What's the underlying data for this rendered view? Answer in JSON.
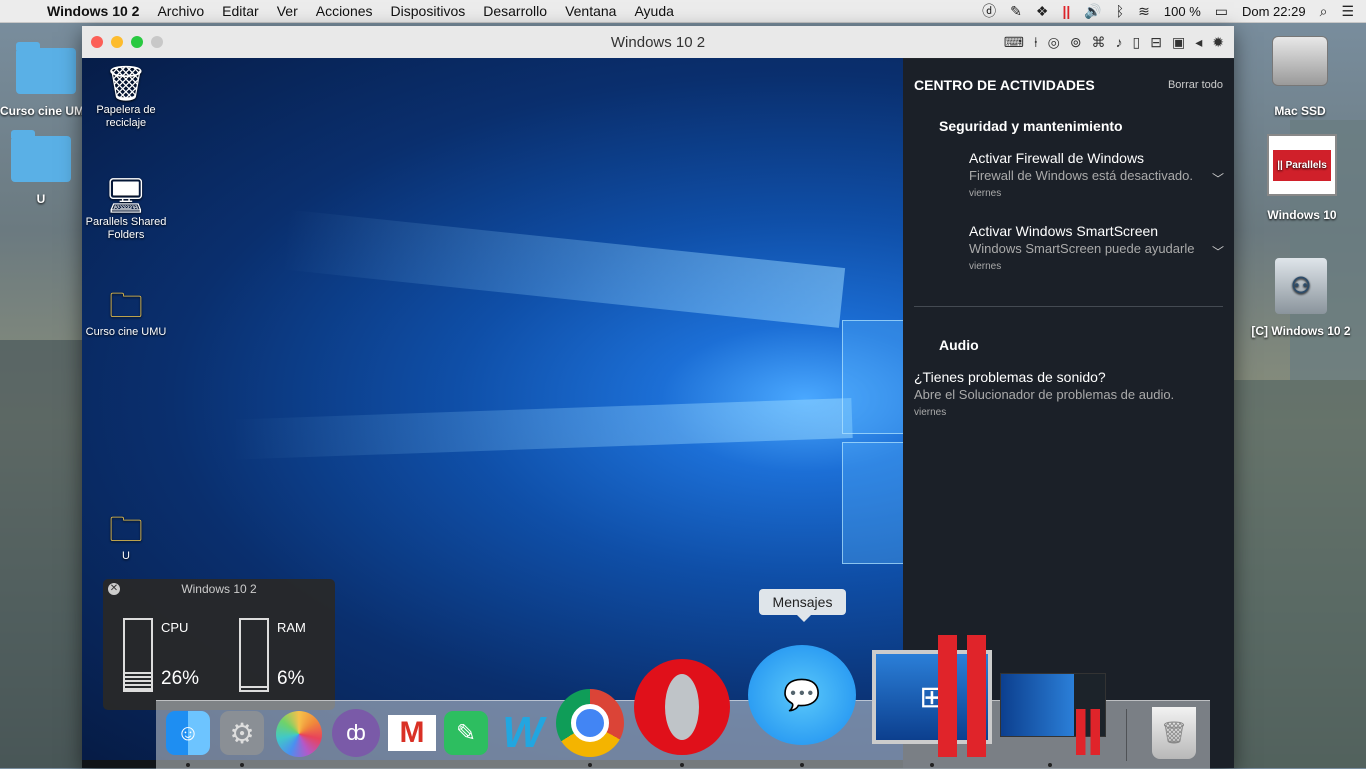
{
  "menubar": {
    "apple_icon": "apple-icon",
    "app_name": "Windows 10 2",
    "menus": [
      "Archivo",
      "Editar",
      "Ver",
      "Acciones",
      "Dispositivos",
      "Desarrollo",
      "Ventana",
      "Ayuda"
    ],
    "battery": "100 %",
    "clock": "Dom 22:29"
  },
  "mac_desktop": {
    "icons": [
      "Curso cine UMU",
      "U",
      "Mac SSD",
      "Windows 10",
      "[C] Windows 10 2"
    ]
  },
  "vm_window": {
    "title": "Windows 10 2"
  },
  "win_desktop": {
    "icons": [
      "Papelera de reciclaje",
      "Parallels Shared Folders",
      "Curso cine UMU",
      "U"
    ]
  },
  "action_center": {
    "title": "CENTRO DE ACTIVIDADES",
    "clear_all": "Borrar todo",
    "section1": "Seguridad y mantenimiento",
    "n1_title": "Activar Firewall de Windows",
    "n1_body": "Firewall de Windows está desactivado.",
    "n1_time": "viernes",
    "n2_title": "Activar Windows SmartScreen",
    "n2_body": "Windows SmartScreen puede ayudarle",
    "n2_time": "viernes",
    "section2": "Audio",
    "n3_title": "¿Tienes problemas de sonido?",
    "n3_body": "Abre el Solucionador de problemas de audio.",
    "n3_time": "viernes"
  },
  "monitor": {
    "title": "Windows 10 2",
    "cpu_label": "CPU",
    "cpu_value": "26%",
    "cpu_level": 0.26,
    "ram_label": "RAM",
    "ram_value": "6%",
    "ram_level": 0.06
  },
  "dock": {
    "tooltip": "Mensajes"
  },
  "colors": {
    "parallels_red": "#e0242a",
    "win_blue": "#1c6fd6",
    "opera_red": "#e0101a"
  }
}
